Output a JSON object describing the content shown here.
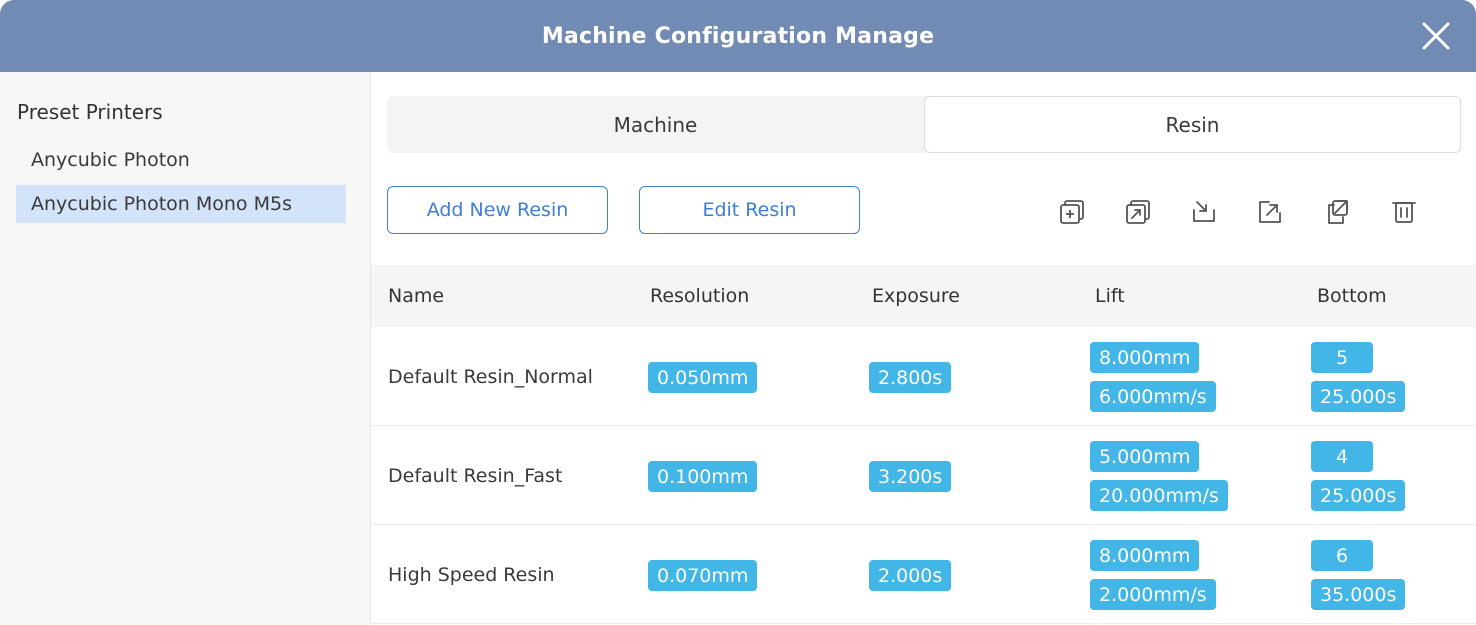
{
  "window": {
    "title": "Machine Configuration Manage",
    "close_icon": "close-icon",
    "header_color": "#728bb4"
  },
  "sidebar": {
    "heading": "Preset Printers",
    "items": [
      {
        "label": "Anycubic Photon",
        "selected": false
      },
      {
        "label": "Anycubic Photon Mono M5s",
        "selected": true
      }
    ]
  },
  "tabs": [
    {
      "label": "Machine",
      "active": false
    },
    {
      "label": "Resin",
      "active": true
    }
  ],
  "actions": {
    "add_label": "Add New Resin",
    "edit_label": "Edit Resin"
  },
  "toolbar_icons": [
    "add-copy-icon",
    "duplicate-icon",
    "import-icon",
    "export-icon",
    "export-all-icon",
    "delete-icon"
  ],
  "table": {
    "columns": [
      "Name",
      "Resolution",
      "Exposure",
      "Lift",
      "Bottom"
    ],
    "rows": [
      {
        "name": "Default Resin_Normal",
        "resolution": "0.050mm",
        "exposure": "2.800s",
        "lift_height": "8.000mm",
        "lift_speed": "6.000mm/s",
        "bottom_layers": "5",
        "bottom_exposure": "25.000s"
      },
      {
        "name": "Default Resin_Fast",
        "resolution": "0.100mm",
        "exposure": "3.200s",
        "lift_height": "5.000mm",
        "lift_speed": "20.000mm/s",
        "bottom_layers": "4",
        "bottom_exposure": "25.000s"
      },
      {
        "name": "High Speed Resin",
        "resolution": "0.070mm",
        "exposure": "2.000s",
        "lift_height": "8.000mm",
        "lift_speed": "2.000mm/s",
        "bottom_layers": "6",
        "bottom_exposure": "35.000s"
      }
    ]
  },
  "colors": {
    "accent": "#3f82d6",
    "chip": "#42b6e6",
    "selected_item": "#d3e3f9"
  }
}
